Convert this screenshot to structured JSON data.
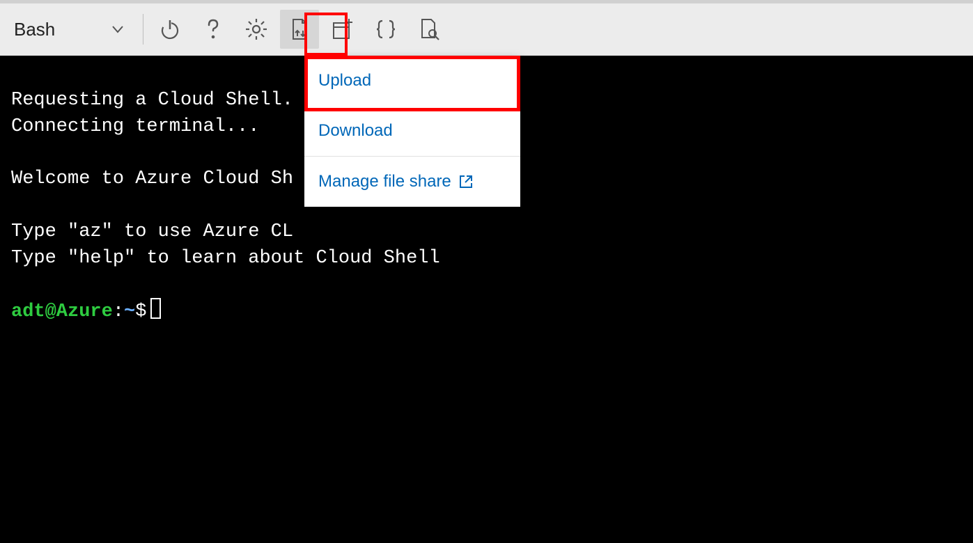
{
  "toolbar": {
    "shell_label": "Bash"
  },
  "menu": {
    "upload": "Upload",
    "download": "Download",
    "manage": "Manage file share"
  },
  "terminal": {
    "lines": {
      "l1": "Requesting a Cloud Shell.",
      "l2": "Connecting terminal...",
      "blank1": "",
      "l3": "Welcome to Azure Cloud Sh",
      "blank2": "",
      "l4": "Type \"az\" to use Azure CL",
      "l5": "Type \"help\" to learn about Cloud Shell",
      "blank3": ""
    },
    "prompt": {
      "userhost": "adt@Azure",
      "colon": ":",
      "path": "~",
      "dollar": "$"
    }
  }
}
